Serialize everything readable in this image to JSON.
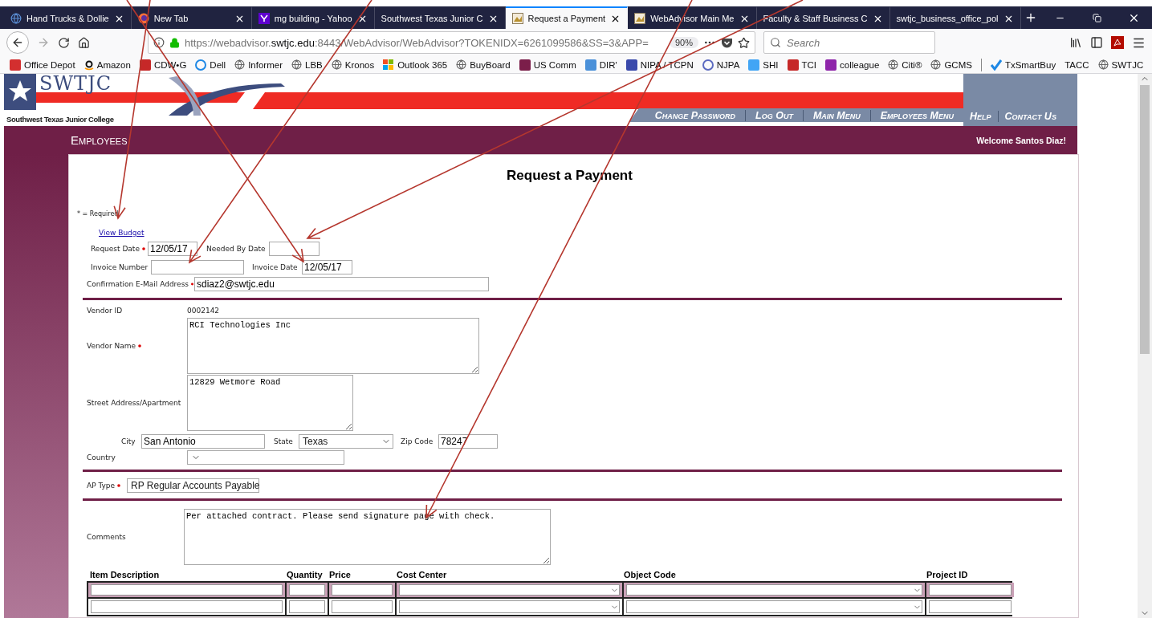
{
  "browser": {
    "tabs": [
      {
        "title": "Hand Trucks & Dollie",
        "kind": "globe",
        "selected": false
      },
      {
        "title": "New Tab",
        "kind": "fox",
        "selected": false
      },
      {
        "title": "mg building - Yahoo",
        "kind": "app",
        "selected": false
      },
      {
        "title": "Southwest Texas Junior C",
        "kind": "plain",
        "selected": false
      },
      {
        "title": "Request a Payment",
        "kind": "picture",
        "selected": true
      },
      {
        "title": "WebAdvisor Main Me",
        "kind": "picture",
        "selected": false
      },
      {
        "title": "Faculty & Staff Business C",
        "kind": "plain",
        "selected": false
      },
      {
        "title": "swtjc_business_office_pol",
        "kind": "plain",
        "selected": false
      }
    ],
    "url": {
      "prefix": "https://webadvisor.",
      "domain": "swtjc.edu",
      "path": ":8443/WebAdvisor/WebAdvisor?TOKENIDX=6261099586&SS=3&APP="
    },
    "zoom": "90%",
    "search_placeholder": "Search",
    "bookmarks": [
      {
        "label": "Office Depot",
        "kind": "square",
        "color": "#d32f2f"
      },
      {
        "label": "Amazon",
        "kind": "smile"
      },
      {
        "label": "CDW•G",
        "kind": "square",
        "color": "#c62828"
      },
      {
        "label": "Dell",
        "kind": "circle",
        "color": "#1e88e5"
      },
      {
        "label": "Informer",
        "kind": "globe"
      },
      {
        "label": "LBB",
        "kind": "globe"
      },
      {
        "label": "Kronos",
        "kind": "globe"
      },
      {
        "label": "Outlook 365",
        "kind": "windows"
      },
      {
        "label": "BuyBoard",
        "kind": "globe"
      },
      {
        "label": "US Comm",
        "kind": "square",
        "color": "#7b1e4a"
      },
      {
        "label": "DIR'",
        "kind": "square",
        "color": "#4a90d9"
      },
      {
        "label": "NIPA / TCPN",
        "kind": "square",
        "color": "#3949ab"
      },
      {
        "label": "NJPA",
        "kind": "circle",
        "color": "#5c6bc0"
      },
      {
        "label": "SHI",
        "kind": "square",
        "color": "#42a5f5"
      },
      {
        "label": "TCI",
        "kind": "square",
        "color": "#c62828"
      },
      {
        "label": "colleague",
        "kind": "square",
        "color": "#8e24aa"
      },
      {
        "label": "Citi®",
        "kind": "globe"
      },
      {
        "label": "GCMS",
        "kind": "globe"
      },
      {
        "label": "TxSmartBuy",
        "kind": "check",
        "color": "#1e88e5",
        "separator_before": true
      },
      {
        "label": "TACC",
        "kind": "plain"
      },
      {
        "label": "SWTJC",
        "kind": "globe"
      }
    ]
  },
  "site": {
    "logo": "SWTJC",
    "college": "Southwest Texas Junior College",
    "nav": [
      "Change Password",
      "Log Out",
      "Main Menu",
      "Employees Menu"
    ],
    "nav_right": [
      "Help",
      "Contact Us"
    ],
    "section": "Employees",
    "welcome": "Welcome Santos Diaz!"
  },
  "form": {
    "title": "Request a Payment",
    "required_note": "* = Required",
    "budget_link": "View Budget",
    "request_date": {
      "label": "Request Date",
      "required": true,
      "value": "12/05/17"
    },
    "needed_by_date": {
      "label": "Needed By Date"
    },
    "invoice_number": {
      "label": "Invoice Number"
    },
    "invoice_date": {
      "label": "Invoice Date",
      "value": "12/05/17"
    },
    "email": {
      "label": "Confirmation E-Mail Address",
      "required": true,
      "value": "sdiaz2@swtjc.edu"
    },
    "vendor_id": {
      "label": "Vendor ID",
      "value": "0002142"
    },
    "vendor_name": {
      "label": "Vendor Name",
      "required": true,
      "value": "RCI Technologies Inc"
    },
    "street": {
      "label": "Street Address/Apartment",
      "value": "12829 Wetmore Road"
    },
    "city": {
      "label": "City",
      "value": "San Antonio"
    },
    "state": {
      "label": "State",
      "value": "Texas"
    },
    "zip": {
      "label": "Zip Code",
      "value": "78247"
    },
    "country": {
      "label": "Country"
    },
    "ap_type": {
      "label": "AP Type",
      "required": true,
      "value": "RP Regular Accounts Payable"
    },
    "comments": {
      "label": "Comments",
      "value": "Per attached contract. Please send signature page with check."
    }
  },
  "items": {
    "columns": [
      {
        "label": "Item Description",
        "kind": "text"
      },
      {
        "label": "Quantity",
        "kind": "text"
      },
      {
        "label": "Price",
        "kind": "text"
      },
      {
        "label": "Cost Center",
        "kind": "select"
      },
      {
        "label": "Object Code",
        "kind": "select"
      },
      {
        "label": "Project ID",
        "kind": "text"
      }
    ],
    "rows": [
      {
        "highlighted": true
      },
      {
        "highlighted": false
      }
    ]
  }
}
